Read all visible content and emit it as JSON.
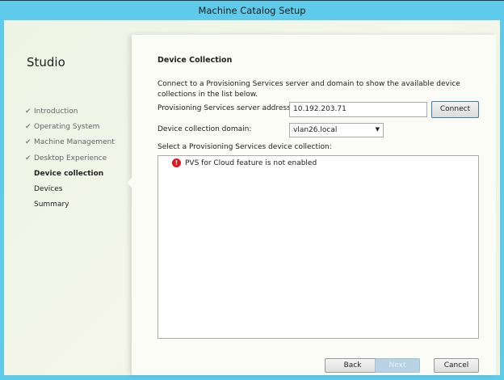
{
  "window": {
    "title": "Machine Catalog Setup"
  },
  "sidebar": {
    "brand": "Studio",
    "items": [
      {
        "label": "Introduction",
        "state": "done"
      },
      {
        "label": "Operating System",
        "state": "done"
      },
      {
        "label": "Machine Management",
        "state": "done"
      },
      {
        "label": "Desktop Experience",
        "state": "done"
      },
      {
        "label": "Device collection",
        "state": "active"
      },
      {
        "label": "Devices",
        "state": "pending"
      },
      {
        "label": "Summary",
        "state": "pending"
      }
    ]
  },
  "main": {
    "heading": "Device Collection",
    "description": "Connect to a Provisioning Services server and domain to show the available device collections in the list below.",
    "server_label": "Provisioning Services server address:",
    "server_value": "10.192.203.71",
    "connect_label": "Connect",
    "domain_label": "Device collection domain:",
    "domain_value": "vlan26.local",
    "select_label": "Select a Provisioning Services device collection:",
    "error_message": "PVS for Cloud feature is not enabled"
  },
  "footer": {
    "back": "Back",
    "next": "Next",
    "cancel": "Cancel"
  },
  "colors": {
    "frame": "#5ecbea",
    "error": "#e0161b"
  }
}
